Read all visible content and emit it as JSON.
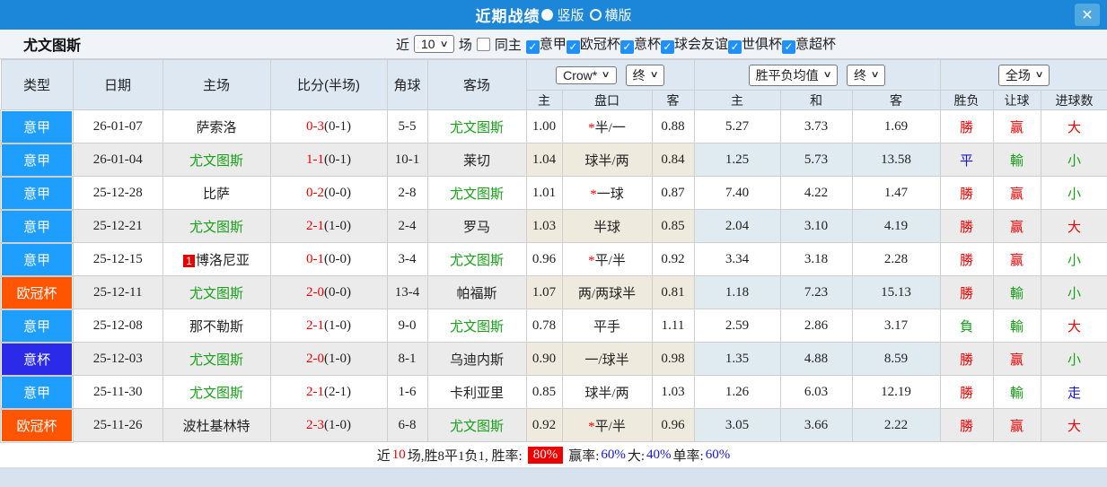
{
  "titlebar": {
    "title": "近期战绩",
    "options": [
      {
        "label": "竖版",
        "selected": true
      },
      {
        "label": "横版",
        "selected": false
      }
    ],
    "close_glyph": "✕"
  },
  "filterbar": {
    "team": "尤文图斯",
    "near_label": "近",
    "count_value": "10",
    "games_label": "场",
    "same_home": {
      "label": "同主",
      "checked": false
    },
    "leagues": [
      {
        "label": "意甲",
        "checked": true
      },
      {
        "label": "欧冠杯",
        "checked": true
      },
      {
        "label": "意杯",
        "checked": true
      },
      {
        "label": "球会友谊",
        "checked": true
      },
      {
        "label": "世俱杯",
        "checked": true
      },
      {
        "label": "意超杯",
        "checked": true
      }
    ]
  },
  "table": {
    "headers": {
      "type": "类型",
      "date": "日期",
      "home": "主场",
      "score": "比分(半场)",
      "corner": "角球",
      "away": "客场"
    },
    "dropdowns": {
      "company": "Crow*",
      "company_final": "终",
      "avg": "胜平负均值",
      "avg_final": "终",
      "scope": "全场"
    },
    "subheaders": [
      "主",
      "盘口",
      "客",
      "主",
      "和",
      "客",
      "胜负",
      "让球",
      "进球数"
    ],
    "type_colors": {
      "意甲": "#1e9fff",
      "欧冠杯": "#ff5500",
      "意杯": "#2a2ae8"
    },
    "rows": [
      {
        "type": "意甲",
        "date": "26-01-07",
        "home": "萨索洛",
        "home_green": false,
        "home_rank": "",
        "score": "0-3",
        "half": "(0-1)",
        "corner": "5-5",
        "away": "尤文图斯",
        "away_green": true,
        "o1": "1.00",
        "hc_star": true,
        "hc": "半/一",
        "o2": "0.88",
        "m1": "5.27",
        "m2": "3.73",
        "m3": "1.69",
        "wl": "勝",
        "wl_c": "red",
        "let": "赢",
        "let_c": "red",
        "ou": "大",
        "ou_c": "red"
      },
      {
        "type": "意甲",
        "date": "26-01-04",
        "home": "尤文图斯",
        "home_green": true,
        "home_rank": "",
        "score": "1-1",
        "half": "(0-1)",
        "corner": "10-1",
        "away": "莱切",
        "away_green": false,
        "o1": "1.04",
        "hc_star": false,
        "hc": "球半/两",
        "o2": "0.84",
        "m1": "1.25",
        "m2": "5.73",
        "m3": "13.58",
        "wl": "平",
        "wl_c": "blue",
        "let": "輸",
        "let_c": "green",
        "ou": "小",
        "ou_c": "green"
      },
      {
        "type": "意甲",
        "date": "25-12-28",
        "home": "比萨",
        "home_green": false,
        "home_rank": "",
        "score": "0-2",
        "half": "(0-0)",
        "corner": "2-8",
        "away": "尤文图斯",
        "away_green": true,
        "o1": "1.01",
        "hc_star": true,
        "hc": "一球",
        "o2": "0.87",
        "m1": "7.40",
        "m2": "4.22",
        "m3": "1.47",
        "wl": "勝",
        "wl_c": "red",
        "let": "赢",
        "let_c": "red",
        "ou": "小",
        "ou_c": "green"
      },
      {
        "type": "意甲",
        "date": "25-12-21",
        "home": "尤文图斯",
        "home_green": true,
        "home_rank": "",
        "score": "2-1",
        "half": "(1-0)",
        "corner": "2-4",
        "away": "罗马",
        "away_green": false,
        "o1": "1.03",
        "hc_star": false,
        "hc": "半球",
        "o2": "0.85",
        "m1": "2.04",
        "m2": "3.10",
        "m3": "4.19",
        "wl": "勝",
        "wl_c": "red",
        "let": "赢",
        "let_c": "red",
        "ou": "大",
        "ou_c": "red"
      },
      {
        "type": "意甲",
        "date": "25-12-15",
        "home": "博洛尼亚",
        "home_green": false,
        "home_rank": "1",
        "score": "0-1",
        "half": "(0-0)",
        "corner": "3-4",
        "away": "尤文图斯",
        "away_green": true,
        "o1": "0.96",
        "hc_star": true,
        "hc": "平/半",
        "o2": "0.92",
        "m1": "3.34",
        "m2": "3.18",
        "m3": "2.28",
        "wl": "勝",
        "wl_c": "red",
        "let": "赢",
        "let_c": "red",
        "ou": "小",
        "ou_c": "green"
      },
      {
        "type": "欧冠杯",
        "date": "25-12-11",
        "home": "尤文图斯",
        "home_green": true,
        "home_rank": "",
        "score": "2-0",
        "half": "(0-0)",
        "corner": "13-4",
        "away": "帕福斯",
        "away_green": false,
        "o1": "1.07",
        "hc_star": false,
        "hc": "两/两球半",
        "o2": "0.81",
        "m1": "1.18",
        "m2": "7.23",
        "m3": "15.13",
        "wl": "勝",
        "wl_c": "red",
        "let": "輸",
        "let_c": "green",
        "ou": "小",
        "ou_c": "green"
      },
      {
        "type": "意甲",
        "date": "25-12-08",
        "home": "那不勒斯",
        "home_green": false,
        "home_rank": "",
        "score": "2-1",
        "half": "(1-0)",
        "corner": "9-0",
        "away": "尤文图斯",
        "away_green": true,
        "o1": "0.78",
        "hc_star": false,
        "hc": "平手",
        "o2": "1.11",
        "m1": "2.59",
        "m2": "2.86",
        "m3": "3.17",
        "wl": "負",
        "wl_c": "green",
        "let": "輸",
        "let_c": "green",
        "ou": "大",
        "ou_c": "red"
      },
      {
        "type": "意杯",
        "date": "25-12-03",
        "home": "尤文图斯",
        "home_green": true,
        "home_rank": "",
        "score": "2-0",
        "half": "(1-0)",
        "corner": "8-1",
        "away": "乌迪内斯",
        "away_green": false,
        "o1": "0.90",
        "hc_star": false,
        "hc": "一/球半",
        "o2": "0.98",
        "m1": "1.35",
        "m2": "4.88",
        "m3": "8.59",
        "wl": "勝",
        "wl_c": "red",
        "let": "赢",
        "let_c": "red",
        "ou": "小",
        "ou_c": "green"
      },
      {
        "type": "意甲",
        "date": "25-11-30",
        "home": "尤文图斯",
        "home_green": true,
        "home_rank": "",
        "score": "2-1",
        "half": "(2-1)",
        "corner": "1-6",
        "away": "卡利亚里",
        "away_green": false,
        "o1": "0.85",
        "hc_star": false,
        "hc": "球半/两",
        "o2": "1.03",
        "m1": "1.26",
        "m2": "6.03",
        "m3": "12.19",
        "wl": "勝",
        "wl_c": "red",
        "let": "輸",
        "let_c": "green",
        "ou": "走",
        "ou_c": "blue"
      },
      {
        "type": "欧冠杯",
        "date": "25-11-26",
        "home": "波杜基林特",
        "home_green": false,
        "home_rank": "",
        "score": "2-3",
        "half": "(1-0)",
        "corner": "6-8",
        "away": "尤文图斯",
        "away_green": true,
        "o1": "0.92",
        "hc_star": true,
        "hc": "平/半",
        "o2": "0.96",
        "m1": "3.05",
        "m2": "3.66",
        "m3": "2.22",
        "wl": "勝",
        "wl_c": "red",
        "let": "赢",
        "let_c": "red",
        "ou": "大",
        "ou_c": "red"
      }
    ]
  },
  "footer": {
    "parts": [
      {
        "text": "近",
        "style": "black"
      },
      {
        "text": "10",
        "style": "red"
      },
      {
        "text": "场,胜8平1负1, 胜率:",
        "style": "black"
      },
      {
        "text": "80%",
        "style": "badge"
      },
      {
        "text": "赢率:",
        "style": "black"
      },
      {
        "text": "60%",
        "style": "blue"
      },
      {
        "text": " 大:",
        "style": "black"
      },
      {
        "text": "40%",
        "style": "blue"
      },
      {
        "text": " 单率:",
        "style": "black"
      },
      {
        "text": "60%",
        "style": "blue"
      }
    ]
  },
  "colors": {
    "topbar": "#1c87d9",
    "serie_a": "#1e9fff",
    "champions": "#ff5500",
    "coppa": "#2a2ae8",
    "win_red": "#ee0000",
    "lose_green": "#18a018",
    "draw_blue": "#1414dd",
    "team_green": "#18a018",
    "badge_red": "#ee0000"
  }
}
